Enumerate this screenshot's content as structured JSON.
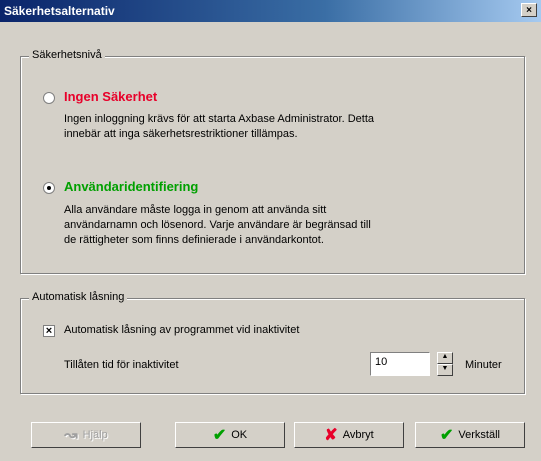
{
  "window": {
    "title": "Säkerhetsalternativ",
    "close_glyph": "×"
  },
  "security": {
    "legend": "Säkerhetsnivå",
    "none": {
      "title": "Ingen Säkerhet",
      "desc_line1": "Ingen inloggning krävs för att starta Axbase Administrator. Detta",
      "desc_line2": "innebär att inga säkerhetsrestriktioner tillämpas.",
      "selected": false,
      "color": "#e8002a"
    },
    "user": {
      "title": "Användaridentifiering",
      "desc_line1": "Alla användare måste logga in genom att använda sitt",
      "desc_line2": "användarnamn och lösenord. Varje användare är begränsad till",
      "desc_line3": "de rättigheter som finns definierade i användarkontot.",
      "selected": true,
      "color": "#00a000"
    }
  },
  "autolock": {
    "legend": "Automatisk låsning",
    "checkbox_label": "Automatisk låsning av programmet vid inaktivitet",
    "checked": true,
    "check_glyph": "×",
    "time_label": "Tillåten tid för inaktivitet",
    "minutes_value": "10",
    "minutes_label": "Minuter"
  },
  "buttons": {
    "help": "Hjälp",
    "ok": "OK",
    "cancel": "Avbryt",
    "apply": "Verkställ"
  },
  "icons": {
    "help": "help-icon",
    "ok": "checkmark-icon",
    "cancel": "cross-icon",
    "apply": "apply-icon"
  }
}
